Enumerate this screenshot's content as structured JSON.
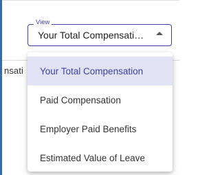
{
  "background": {
    "column_fragment": "nsati"
  },
  "view_select": {
    "legend": "View",
    "value": "Your Total Compensati…",
    "arrow_icon": "arrow-up-icon",
    "accent_color": "#3f3fa8"
  },
  "menu": {
    "items": [
      {
        "label": "Your Total Compensation",
        "selected": true
      },
      {
        "label": "Paid Compensation",
        "selected": false
      },
      {
        "label": "Employer Paid Benefits",
        "selected": false
      },
      {
        "label": "Estimated Value of Leave",
        "selected": false
      }
    ],
    "selected_bg": "#e1e2f3"
  }
}
